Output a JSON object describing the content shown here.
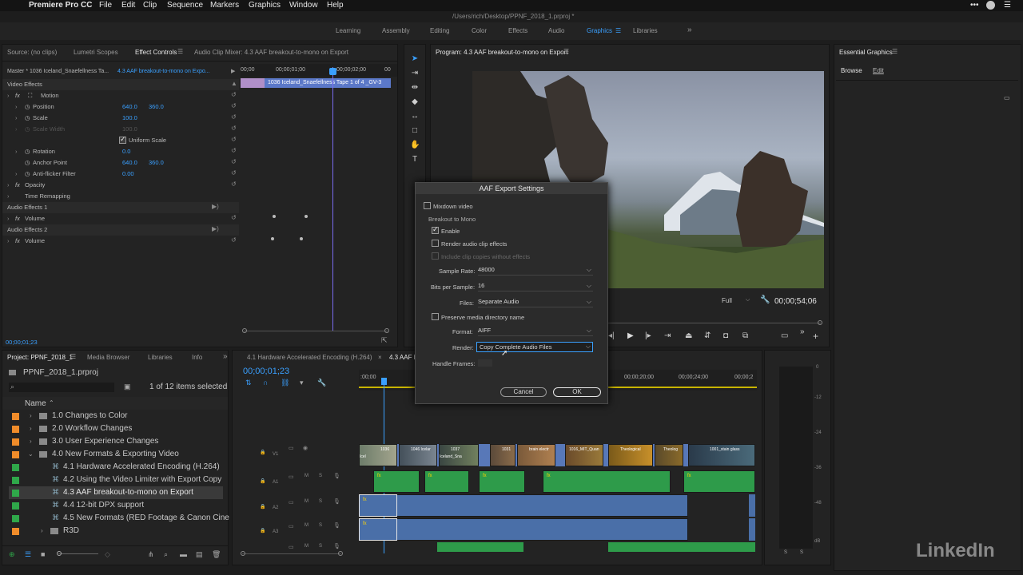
{
  "menubar": {
    "apple": "",
    "app": "Premiere Pro CC",
    "items": [
      "File",
      "Edit",
      "Clip",
      "Sequence",
      "Markers",
      "Graphics",
      "Window",
      "Help"
    ]
  },
  "window_title": "/Users/rich/Desktop/PPNF_2018_1.prproj *",
  "workspaces": {
    "items": [
      "Learning",
      "Assembly",
      "Editing",
      "Color",
      "Effects",
      "Audio",
      "Graphics",
      "Libraries"
    ],
    "active": "Graphics",
    "more": "»"
  },
  "source_panel": {
    "tabs": [
      "Source: (no clips)",
      "Lumetri Scopes",
      "Effect Controls",
      "Audio Clip Mixer: 4.3 AAF breakout-to-mono on Export"
    ],
    "active_tab": "Effect Controls",
    "master_label": "Master * 1036 Iceland_Snaefellness Ta...",
    "sequence_label": "4.3 AAF breakout-to-mono on Expo...",
    "ruler": [
      "00;00",
      "00;00;01;00",
      "00;00;02;00",
      "00"
    ],
    "clip_name": "1036 Iceland_Snaefellness Tape 1 of 4 _GV-3",
    "timecode": "00;00;01;23",
    "rows": {
      "video_effects": "Video Effects",
      "motion": "Motion",
      "position": "Position",
      "position_x": "640.0",
      "position_y": "360.0",
      "scale": "Scale",
      "scale_val": "100.0",
      "scale_width": "Scale Width",
      "scale_width_val": "100.0",
      "uniform_scale": "Uniform Scale",
      "rotation": "Rotation",
      "rotation_val": "0.0",
      "anchor": "Anchor Point",
      "anchor_x": "640.0",
      "anchor_y": "360.0",
      "antiflicker": "Anti-flicker Filter",
      "antiflicker_val": "0.00",
      "opacity": "Opacity",
      "time_remap": "Time Remapping",
      "audio_effects_1": "Audio Effects 1",
      "volume_1": "Volume",
      "audio_effects_2": "Audio Effects 2",
      "volume_2": "Volume"
    }
  },
  "program": {
    "title": "Program: 4.3 AAF breakout-to-mono on Export",
    "zoom": "Full",
    "timecode": "00;00;54;06"
  },
  "essential_graphics": {
    "title": "Essential Graphics",
    "tabs": [
      "Browse",
      "Edit"
    ],
    "active_tab": "Edit"
  },
  "dialog": {
    "title": "AAF Export Settings",
    "mixdown_video": "Mixdown video",
    "breakout_group": "Breakout to Mono",
    "enable": "Enable",
    "render_audio_clip_effects": "Render audio clip effects",
    "include_clip_copies": "Include clip copies without effects",
    "sample_rate_label": "Sample Rate:",
    "sample_rate": "48000",
    "bits_label": "Bits per Sample:",
    "bits": "16",
    "files_label": "Files:",
    "files": "Separate Audio",
    "preserve_dir": "Preserve media directory name",
    "format_label": "Format:",
    "format": "AIFF",
    "render_label": "Render:",
    "render": "Copy Complete Audio Files",
    "handle_frames_label": "Handle Frames:",
    "cancel": "Cancel",
    "ok": "OK"
  },
  "project": {
    "tabs": [
      "Project: PPNF_2018_1",
      "Media Browser",
      "Libraries",
      "Info"
    ],
    "active_tab": "Project: PPNF_2018_1",
    "file": "PPNF_2018_1.prproj",
    "selection_count": "1 of 12 items selected",
    "column_name": "Name",
    "rows": [
      {
        "name": "1.0 Changes to Color",
        "type": "folder",
        "color": "#f08c2a"
      },
      {
        "name": "2.0 Workflow Changes",
        "type": "folder",
        "color": "#f08c2a"
      },
      {
        "name": "3.0 User Experience Changes",
        "type": "folder",
        "color": "#f08c2a"
      },
      {
        "name": "4.0 New Formats & Exporting Video",
        "type": "folder",
        "color": "#f08c2a"
      },
      {
        "name": "4.1 Hardware Accelerated Encoding (H.264)",
        "type": "sequence",
        "color": "#2fa84a"
      },
      {
        "name": "4.2 Using the Video Limiter with Export Copy",
        "type": "sequence",
        "color": "#2fa84a"
      },
      {
        "name": "4.3 AAF breakout-to-mono on Export",
        "type": "sequence",
        "color": "#2fa84a"
      },
      {
        "name": "4.4 12-bit DPX support",
        "type": "sequence",
        "color": "#2fa84a"
      },
      {
        "name": "4.5 New Formats (RED Footage & Canon Cine",
        "type": "sequence",
        "color": "#2fa84a"
      },
      {
        "name": "R3D",
        "type": "folder",
        "color": "#f08c2a"
      }
    ]
  },
  "timeline": {
    "tabs": [
      "4.1 Hardware Accelerated Encoding (H.264)",
      "4.3 AAF br"
    ],
    "timecode": "00;00;01;23",
    "ruler": [
      ":00;00",
      "00;00;20;00",
      "00;00;24;00",
      "00;00;2"
    ],
    "tracks": [
      "V1",
      "A1",
      "A2",
      "A3"
    ],
    "video_clips": [
      "1036 Icel",
      "1046 Icelar",
      "1037 Iceland_Sna",
      "1031",
      "brain electr",
      "1016_MIT_Quan",
      "Theological",
      "Theolog",
      "1001_stain glass"
    ]
  },
  "watermark": "LinkedIn"
}
